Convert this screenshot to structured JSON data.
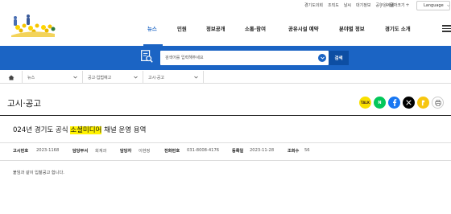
{
  "util": {
    "links": [
      "경기도의회",
      "조직도",
      "날씨",
      "대기정보",
      "공무원메일"
    ],
    "font_size_label": "글자크기",
    "language_label": "Language"
  },
  "gnb": {
    "items": [
      "뉴스",
      "민원",
      "정보공개",
      "소통·참여",
      "공유시설 예약",
      "분야별 정보",
      "경기도 소개"
    ],
    "active_index": 0
  },
  "search": {
    "placeholder": "검색어를 입력해주세요",
    "button_label": "검색"
  },
  "breadcrumb": [
    "뉴스",
    "공고·입법예고",
    "고시·공고"
  ],
  "page_title": "고시·공고",
  "share": {
    "kakaotalk": "TALK",
    "naver": "N",
    "colors": {
      "kakaotalk": "#f9e000",
      "naver": "#03c75a",
      "facebook": "#1877f2",
      "x": "#000000",
      "kakaostory": "#f7c60f"
    }
  },
  "article": {
    "title_before": "024년 경기도 공식 ",
    "title_highlight": "소셜미디어",
    "title_after": " 채널 운영 용역",
    "meta": {
      "notice_no_label": "고시번호",
      "notice_no": "2023-1168",
      "dept_label": "담당부서",
      "dept": "회계과",
      "person_label": "담당자",
      "person": "이현정",
      "phone_label": "전화번호",
      "phone": "031-8008-4176",
      "date_label": "등록일",
      "date": "2023-11-28",
      "views_label": "조회수",
      "views": "56"
    },
    "body": "붙임과 같이 입찰공고 합니다."
  },
  "colors": {
    "primary": "#1b64c4",
    "highlight": "#fff200"
  }
}
